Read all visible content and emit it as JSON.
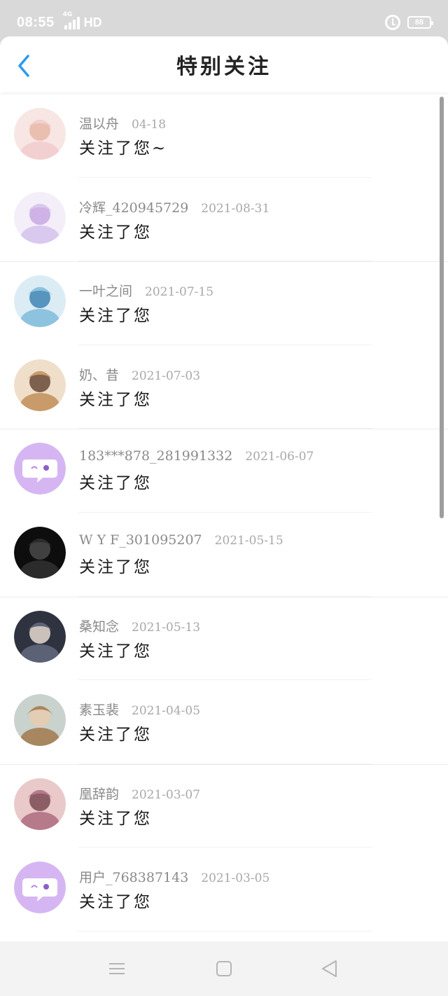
{
  "status_bar": {
    "time": "08:55",
    "network": "4G",
    "hd": "HD",
    "battery": "88"
  },
  "header": {
    "title": "特别关注"
  },
  "list": [
    {
      "name": "温以舟",
      "date": "04-18",
      "action": "关注了您~",
      "avatar": "anime-pink"
    },
    {
      "name": "冷辉_420945729",
      "date": "2021-08-31",
      "action": "关注了您",
      "avatar": "anime-lavender"
    },
    {
      "name": "一叶之间",
      "date": "2021-07-15",
      "action": "关注了您",
      "avatar": "anime-blue"
    },
    {
      "name": "奶、昔",
      "date": "2021-07-03",
      "action": "关注了您",
      "avatar": "anime-brown"
    },
    {
      "name": "183***878_281991332",
      "date": "2021-06-07",
      "action": "关注了您",
      "avatar": "default-chat"
    },
    {
      "name": "W Y F_301095207",
      "date": "2021-05-15",
      "action": "关注了您",
      "avatar": "photo-dark"
    },
    {
      "name": "桑知念",
      "date": "2021-05-13",
      "action": "关注了您",
      "avatar": "anime-hat"
    },
    {
      "name": "素玉裴",
      "date": "2021-04-05",
      "action": "关注了您",
      "avatar": "anime-gray"
    },
    {
      "name": "凰辞韵",
      "date": "2021-03-07",
      "action": "关注了您",
      "avatar": "anime-rose"
    },
    {
      "name": "用户_768387143",
      "date": "2021-03-05",
      "action": "关注了您",
      "avatar": "default-chat"
    }
  ],
  "colors": {
    "accent": "#2b9af3",
    "default_avatar": "#d6b6f2"
  }
}
